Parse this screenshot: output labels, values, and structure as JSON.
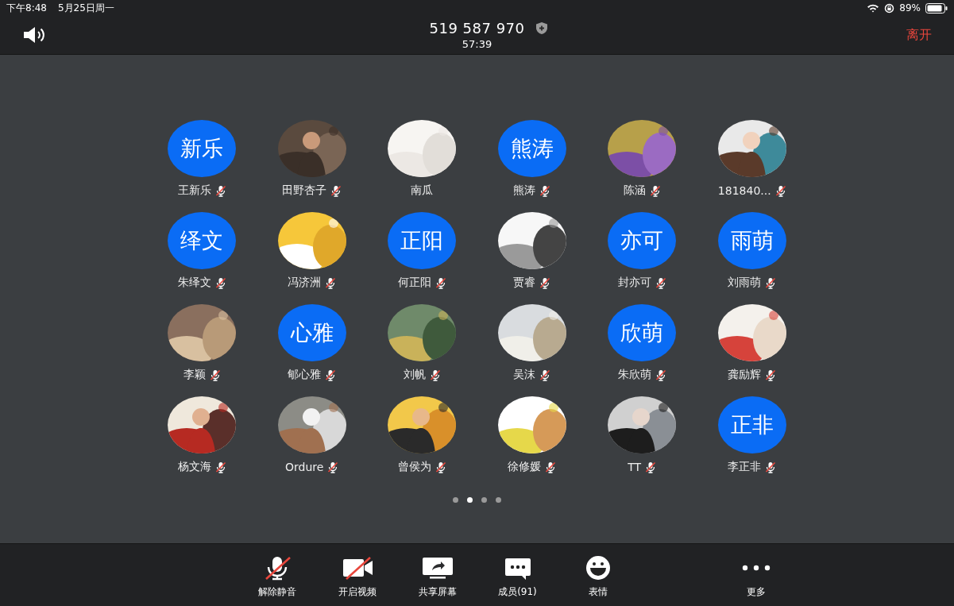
{
  "status_bar": {
    "time": "下午8:48",
    "date": "5月25日周一",
    "battery": "89%"
  },
  "header": {
    "meeting_id": "519 587 970",
    "duration": "57:39",
    "leave": "离开"
  },
  "participants": [
    {
      "name": "王新乐",
      "kind": "initials",
      "initials": "新乐",
      "muted": true
    },
    {
      "name": "田野杏子",
      "kind": "picture",
      "muted": true
    },
    {
      "name": "南瓜",
      "kind": "picture",
      "muted": false
    },
    {
      "name": "熊涛",
      "kind": "initials",
      "initials": "熊涛",
      "muted": true
    },
    {
      "name": "陈涵",
      "kind": "picture",
      "muted": true
    },
    {
      "name": "181840...",
      "kind": "picture",
      "muted": true
    },
    {
      "name": "朱绎文",
      "kind": "initials",
      "initials": "绎文",
      "muted": true
    },
    {
      "name": "冯济洲",
      "kind": "picture",
      "muted": true
    },
    {
      "name": "何正阳",
      "kind": "initials",
      "initials": "正阳",
      "muted": true
    },
    {
      "name": "贾睿",
      "kind": "picture",
      "muted": true
    },
    {
      "name": "封亦可",
      "kind": "initials",
      "initials": "亦可",
      "muted": true
    },
    {
      "name": "刘雨萌",
      "kind": "initials",
      "initials": "雨萌",
      "muted": true
    },
    {
      "name": "李颖",
      "kind": "picture",
      "muted": true
    },
    {
      "name": "郇心雅",
      "kind": "initials",
      "initials": "心雅",
      "muted": true
    },
    {
      "name": "刘帆",
      "kind": "picture",
      "muted": true
    },
    {
      "name": "吴沫",
      "kind": "picture",
      "muted": true
    },
    {
      "name": "朱欣萌",
      "kind": "initials",
      "initials": "欣萌",
      "muted": true
    },
    {
      "name": "龚励辉",
      "kind": "picture",
      "muted": true
    },
    {
      "name": "杨文海",
      "kind": "picture",
      "muted": true
    },
    {
      "name": "Ordure",
      "kind": "picture",
      "muted": true
    },
    {
      "name": "曾侯为",
      "kind": "picture",
      "muted": true
    },
    {
      "name": "徐修媛",
      "kind": "picture",
      "muted": true
    },
    {
      "name": "TT",
      "kind": "picture",
      "muted": true
    },
    {
      "name": "李正非",
      "kind": "initials",
      "initials": "正非",
      "muted": true
    }
  ],
  "pages": [
    {
      "selected": false
    },
    {
      "selected": true
    },
    {
      "selected": false
    },
    {
      "selected": false
    }
  ],
  "toolbar": [
    {
      "kind": "mic",
      "label": "解除静音",
      "off": true
    },
    {
      "kind": "video",
      "label": "开启视频",
      "off": true
    },
    {
      "kind": "share",
      "label": "共享屏幕",
      "off": false
    },
    {
      "kind": "members",
      "label": "成员(91)",
      "off": false
    },
    {
      "kind": "emoji",
      "label": "表情",
      "off": false
    },
    {
      "kind": "more",
      "label": "更多"
    }
  ]
}
